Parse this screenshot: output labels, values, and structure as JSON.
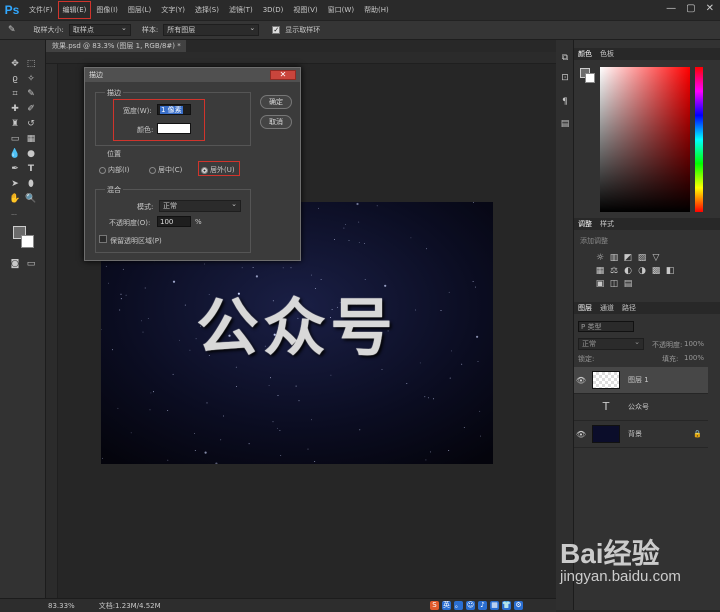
{
  "app": {
    "logo": "Ps"
  },
  "menubar": {
    "items": [
      "文件(F)",
      "编辑(E)",
      "图像(I)",
      "图层(L)",
      "文字(Y)",
      "选择(S)",
      "滤镜(T)",
      "3D(D)",
      "视图(V)",
      "窗口(W)",
      "帮助(H)"
    ],
    "highlighted": "编辑(E)"
  },
  "options": {
    "sample_size_label": "取样大小:",
    "sample_size_value": "取样点",
    "sample_label": "样本:",
    "sample_value": "所有图层",
    "show_ring_label": "显示取样环"
  },
  "document": {
    "tab_title": "效果.psd @ 83.3% (图层 1, RGB/8#) *",
    "zoom": "83.33%",
    "doc_info": "文档:1.23M/4.52M",
    "artwork_text": "公众号"
  },
  "dialog": {
    "title": "描边",
    "section_stroke": "描边",
    "width_label": "宽度(W):",
    "width_value": "1 像素",
    "color_label": "颜色:",
    "color_value": "#ffffff",
    "section_position": "位置",
    "pos_inside": "内部(I)",
    "pos_center": "居中(C)",
    "pos_outside": "居外(U)",
    "selected_position": "居外(U)",
    "section_blend": "混合",
    "mode_label": "模式:",
    "mode_value": "正常",
    "opacity_label": "不透明度(O):",
    "opacity_value": "100",
    "opacity_unit": "%",
    "preserve_label": "保留透明区域(P)",
    "ok_label": "确定",
    "cancel_label": "取消"
  },
  "panels": {
    "color_tabs": [
      "颜色",
      "色板"
    ],
    "adjust_tabs": [
      "调整",
      "样式"
    ],
    "adjust_hint": "添加调整",
    "layers_tabs": [
      "图层",
      "通道",
      "路径"
    ],
    "layer_search": "P 类型",
    "blend_mode": "正常",
    "opacity_label": "不透明度:",
    "opacity_value": "100%",
    "lock_label": "锁定:",
    "fill_label": "填充:",
    "fill_value": "100%",
    "layers": [
      {
        "name": "图层 1",
        "active": true,
        "visible": true,
        "thumb": "white"
      },
      {
        "name": "公众号",
        "active": false,
        "visible": false,
        "thumb": "text"
      },
      {
        "name": "背景",
        "active": false,
        "visible": true,
        "thumb": "dark",
        "locked": true
      }
    ]
  },
  "watermark": {
    "brand": "Bai经验",
    "url": "jingyan.baidu.com"
  },
  "taskbar": {
    "items": [
      "S",
      "英",
      "。",
      "☺",
      "♪",
      "▦",
      "👕",
      "⚙"
    ]
  },
  "colors": {
    "accent": "#31a8ff",
    "highlight_box": "#d0342c"
  }
}
